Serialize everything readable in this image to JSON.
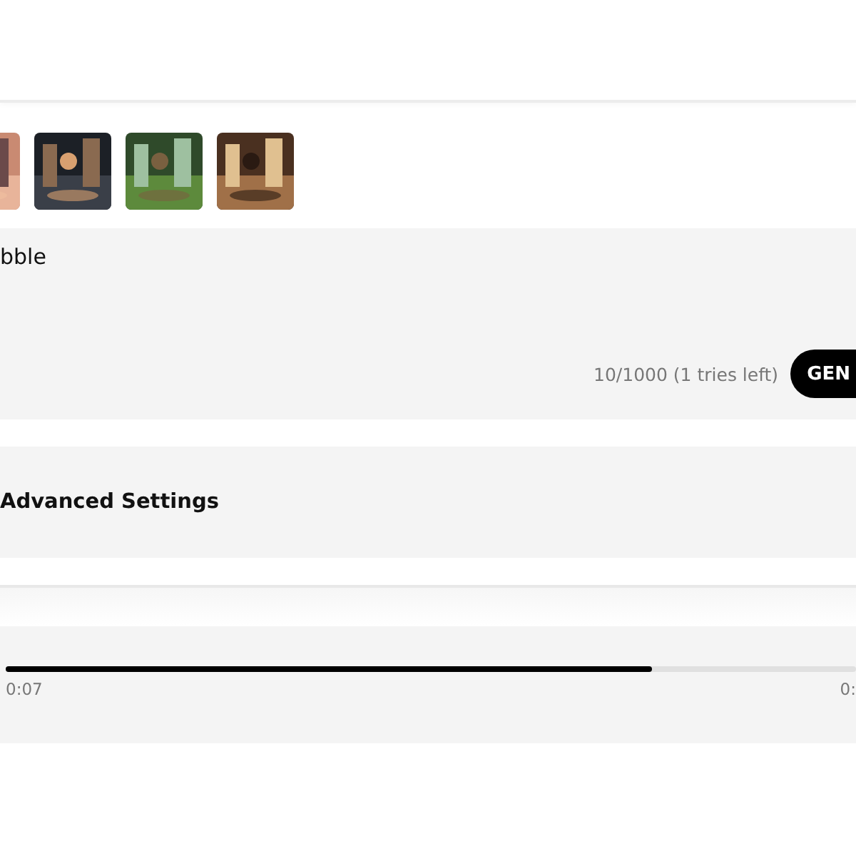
{
  "prompt": {
    "value": "bble",
    "counter": "10/1000 (1 tries left)",
    "button": "GEN"
  },
  "advanced_settings": {
    "label": "Advanced Settings"
  },
  "player": {
    "level": 0.76,
    "elapsed": "0:07",
    "total": "0:"
  }
}
